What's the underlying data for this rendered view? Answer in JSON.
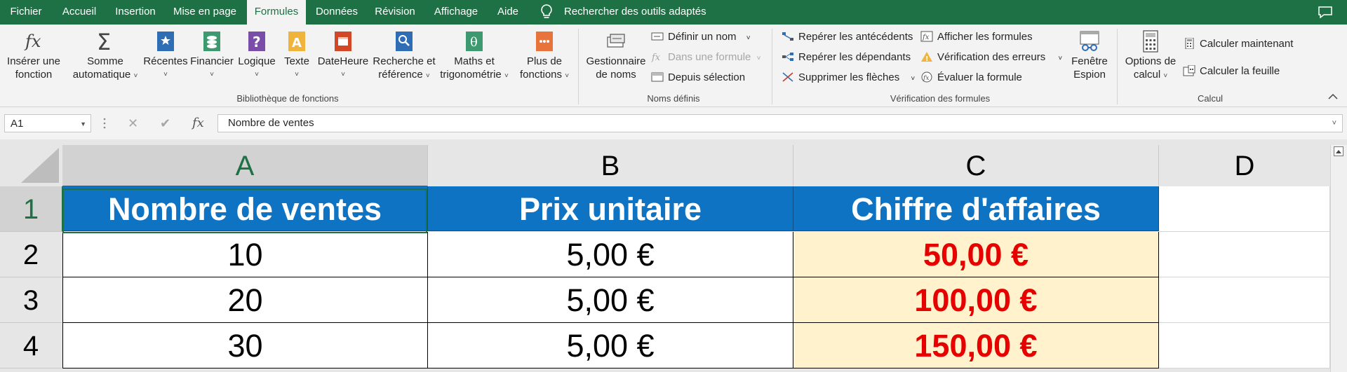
{
  "menu": {
    "tabs": [
      "Fichier",
      "Accueil",
      "Insertion",
      "Mise en page",
      "Formules",
      "Données",
      "Révision",
      "Affichage",
      "Aide"
    ],
    "active_tab": "Formules",
    "search": "Rechercher des outils adaptés"
  },
  "ribbon": {
    "library": {
      "insert_function": [
        "Insérer une",
        "fonction"
      ],
      "autosum": [
        "Somme",
        "automatique"
      ],
      "recent": "Récentes",
      "financial": "Financier",
      "logical": "Logique",
      "text": "Texte",
      "datetime": "DateHeure",
      "lookup": [
        "Recherche et",
        "référence"
      ],
      "math": [
        "Maths et",
        "trigonométrie"
      ],
      "more": [
        "Plus de",
        "fonctions"
      ],
      "group_label": "Bibliothèque de fonctions"
    },
    "names": {
      "manager": [
        "Gestionnaire",
        "de noms"
      ],
      "define_name": "Définir un nom",
      "use_in_formula": "Dans une formule",
      "create_from_selection": "Depuis sélection",
      "group_label": "Noms définis"
    },
    "audit": {
      "trace_precedents": "Repérer les antécédents",
      "trace_dependents": "Repérer les dépendants",
      "remove_arrows": "Supprimer les flèches",
      "show_formulas": "Afficher les formules",
      "error_checking": "Vérification des erreurs",
      "evaluate_formula": "Évaluer la formule",
      "watch_window": [
        "Fenêtre",
        "Espion"
      ],
      "group_label": "Vérification des formules"
    },
    "calc": {
      "options": [
        "Options de",
        "calcul"
      ],
      "calc_now": "Calculer maintenant",
      "calc_sheet": "Calculer la feuille",
      "group_label": "Calcul"
    }
  },
  "formula_bar": {
    "name_box": "A1",
    "fx": "fx",
    "content": "Nombre de ventes"
  },
  "sheet": {
    "columns": [
      "A",
      "B",
      "C",
      "D"
    ],
    "rows": [
      "1",
      "2",
      "3",
      "4"
    ],
    "header": [
      "Nombre de ventes",
      "Prix unitaire",
      "Chiffre d'affaires"
    ],
    "data": [
      [
        "10",
        "5,00 €",
        "50,00 €"
      ],
      [
        "20",
        "5,00 €",
        "100,00 €"
      ],
      [
        "30",
        "5,00 €",
        "150,00 €"
      ]
    ]
  },
  "colors": {
    "excel_green": "#1e7145",
    "header_blue": "#0f73c4",
    "total_fill": "#fff2cc",
    "total_text": "#e60000"
  }
}
